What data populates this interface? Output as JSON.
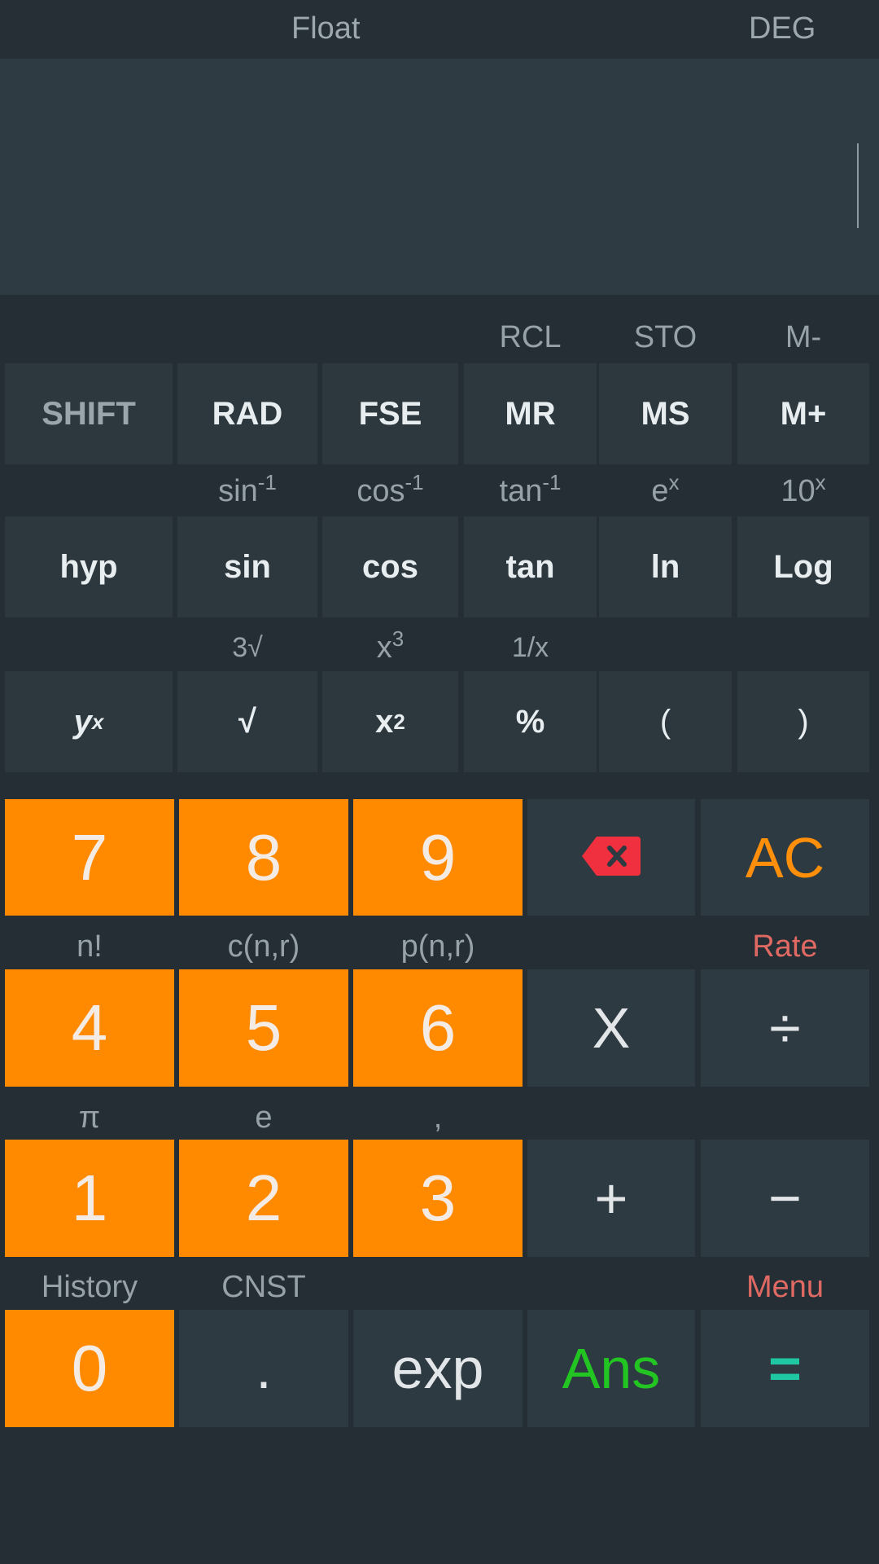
{
  "status": {
    "float": "Float",
    "angle": "DEG"
  },
  "sci": {
    "row1_labels": [
      "",
      "",
      "",
      "RCL",
      "STO",
      "M-"
    ],
    "row1": [
      "SHIFT",
      "RAD",
      "FSE",
      "MR",
      "MS",
      "M+"
    ],
    "row2_labels": [
      "",
      "sin",
      "cos",
      "tan",
      "e",
      "10"
    ],
    "row2_sup": [
      "",
      "-1",
      "-1",
      "-1",
      "x",
      "x"
    ],
    "row2": [
      "hyp",
      "sin",
      "cos",
      "tan",
      "ln",
      "Log"
    ],
    "row3_labels": [
      "",
      "3√",
      "x",
      "1/x",
      "",
      ""
    ],
    "row3_sup": [
      "",
      "",
      "3",
      "",
      "",
      ""
    ],
    "row3": [
      "y",
      "√",
      "x",
      "%",
      "(",
      ")"
    ],
    "row3_sup_btn": [
      "x",
      "",
      "2",
      "",
      "",
      ""
    ]
  },
  "keypad": {
    "row1": [
      "7",
      "8",
      "9",
      "",
      "AC"
    ],
    "row2_labels": [
      "n!",
      "c(n,r)",
      "p(n,r)",
      "",
      "Rate"
    ],
    "row2": [
      "4",
      "5",
      "6",
      "X",
      "÷"
    ],
    "row3_labels": [
      "π",
      "e",
      ",",
      "",
      ""
    ],
    "row3": [
      "1",
      "2",
      "3",
      "+",
      "−"
    ],
    "row4_labels": [
      "History",
      "CNST",
      "",
      "",
      "Menu"
    ],
    "row4": [
      "0",
      ".",
      "exp",
      "Ans",
      "="
    ]
  },
  "icons": {
    "backspace": "backspace-icon"
  },
  "colors": {
    "background": "#252e35",
    "display": "#2e3b42",
    "digit_key": "#ff8a00",
    "ac": "#ff8f0a",
    "ans": "#22c522",
    "equals": "#1fc8a2",
    "accent_label": "#e06a63",
    "backspace": "#f0303e"
  }
}
